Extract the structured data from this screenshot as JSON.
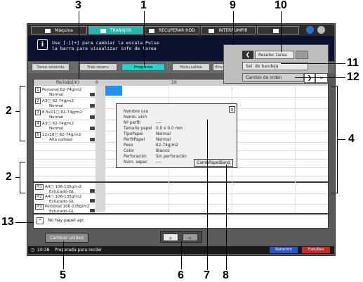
{
  "callouts": [
    "1",
    "2",
    "3",
    "4",
    "5",
    "6",
    "7",
    "8",
    "9",
    "10",
    "11",
    "12",
    "13",
    "2"
  ],
  "topbar": {
    "tabs": [
      "Máquina",
      "TRABAJOS",
      "RECUPERAR HDD",
      "INTERRUMPIR"
    ]
  },
  "message": {
    "info_glyph": "i",
    "line1": "Use [-][+] para cambiar la escala Pulse",
    "line2": "la barra para visualizar info de tarea"
  },
  "popmenu": {
    "reselect": "Reselec.tarea",
    "tray_select": "Sel. de bandeja",
    "order_change": "Cambio de orden"
  },
  "subtabs": [
    "Tarea retenida",
    "Trab.reserv.",
    "Programa",
    "Histo.salida",
    "Env"
  ],
  "timeline": {
    "label": "Periodo(m)",
    "tick0": "0",
    "tick10": "10"
  },
  "rows": [
    {
      "num": "1",
      "line1": "Personal   62-74g/m2",
      "line2": "Normal"
    },
    {
      "num": "2",
      "line1": "A3□      62-74g/m2",
      "line2": "Normal"
    },
    {
      "num": "3",
      "line1": "8.5x11□   62-74g/m2",
      "line2": "Normal"
    },
    {
      "num": "4",
      "line1": "A3□      62-74g/m2",
      "line2": "Normal"
    },
    {
      "num": "5",
      "line1": "12x18□   62-74g/m2",
      "line2": "Alta calidad"
    }
  ],
  "pi_rows": [
    {
      "num": "PI1",
      "line1": "A4□     106-135g/m2",
      "line2": "Estucado-GL"
    },
    {
      "num": "PI2",
      "line1": "A4□     106-135g/m2",
      "line2": "Estucado-GL"
    },
    {
      "num": "PI3",
      "line1": "Personal  106-135g/m2",
      "line2": "Estucado-GL"
    }
  ],
  "no_paper": "No hay papel apr.",
  "popup": {
    "close_glyph": "x",
    "fields": [
      {
        "label": "Nombre usu",
        "value": ""
      },
      {
        "label": "Nomb. arch",
        "value": ""
      },
      {
        "label": "Nº perfil",
        "value": "----"
      },
      {
        "label": "Tamaño papel",
        "value": "0.0 x    0.0 mm"
      },
      {
        "label": "TipoPapel",
        "value": "Normal"
      },
      {
        "label": "PerfilPapel",
        "value": "Normal"
      },
      {
        "label": "Peso",
        "value": "62-74g/m2"
      },
      {
        "label": "Color",
        "value": "Blanco"
      },
      {
        "label": "Perforación",
        "value": "Sin perforación"
      },
      {
        "label": "Núm. separ.",
        "value": "----"
      }
    ],
    "button": "CambPapelBand"
  },
  "bottom": {
    "change_unit": "Cambiar unidad"
  },
  "status": {
    "time": "10:38",
    "text": "Preparada para recibir",
    "rotation": "Rotación",
    "trab": "Trab/Rev"
  }
}
